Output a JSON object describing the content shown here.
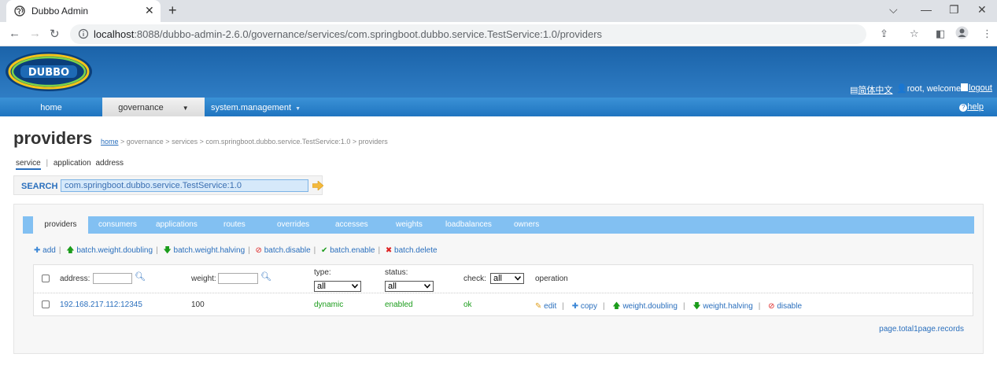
{
  "browser": {
    "tab_title": "Dubbo Admin",
    "url_host": "localhost",
    "url_rest": ":8088/dubbo-admin-2.6.0/governance/services/com.springboot.dubbo.service.TestService:1.0/providers"
  },
  "header": {
    "logo_text": "DUBBO",
    "lang": "简体中文",
    "welcome": "root, welcome",
    "logout": "logout",
    "help": "help"
  },
  "menu": {
    "home": "home",
    "governance": "governance",
    "system": "system.management"
  },
  "page": {
    "title": "providers",
    "breadcrumb_home": "home",
    "breadcrumb_rest": " > governance > services > com.springboot.dubbo.service.TestService:1.0 > providers"
  },
  "subtabs": {
    "service": "service",
    "sep": "|",
    "application": "application",
    "address": "address"
  },
  "search": {
    "label": "SEARCH",
    "value": "com.springboot.dubbo.service.TestService:1.0"
  },
  "tabs": [
    "providers",
    "consumers",
    "applications",
    "routes",
    "overrides",
    "accesses",
    "weights",
    "loadbalances",
    "owners"
  ],
  "actions": {
    "add": "add",
    "doubling": "batch.weight.doubling",
    "halving": "batch.weight.halving",
    "disable": "batch.disable",
    "enable": "batch.enable",
    "delete": "batch.delete"
  },
  "table": {
    "address_label": "address:",
    "weight_label": "weight:",
    "type_label": "type:",
    "type_value": "all",
    "status_label": "status:",
    "status_value": "all",
    "check_label": "check:",
    "check_value": "all",
    "operation_label": "operation",
    "row": {
      "address": "192.168.217.112:12345",
      "weight": "100",
      "type": "dynamic",
      "status": "enabled",
      "check": "ok",
      "edit": "edit",
      "copy": "copy",
      "doubling": "weight.doubling",
      "halving": "weight.halving",
      "disable": "disable"
    }
  },
  "pager": "page.total1page.records"
}
